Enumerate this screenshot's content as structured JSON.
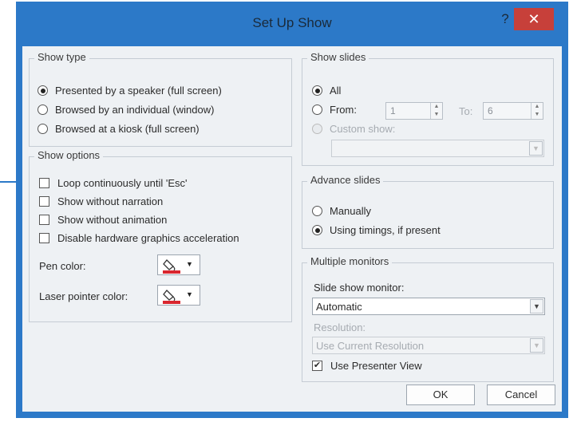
{
  "dialog": {
    "title": "Set Up Show",
    "help_glyph": "?",
    "close_glyph": "✕"
  },
  "show_type": {
    "legend": "Show type",
    "options": [
      {
        "label": "Presented by a speaker (full screen)",
        "selected": true
      },
      {
        "label": "Browsed by an individual (window)",
        "selected": false
      },
      {
        "label": "Browsed at a kiosk (full screen)",
        "selected": false
      }
    ]
  },
  "show_options": {
    "legend": "Show options",
    "checkboxes": [
      {
        "label": "Loop continuously until 'Esc'",
        "checked": false
      },
      {
        "label": "Show without narration",
        "checked": false
      },
      {
        "label": "Show without animation",
        "checked": false
      },
      {
        "label": "Disable hardware graphics acceleration",
        "checked": false
      }
    ],
    "pen_color_label": "Pen color:",
    "laser_color_label": "Laser pointer color:",
    "pen_color": "#d9262e",
    "laser_color": "#d9262e"
  },
  "show_slides": {
    "legend": "Show slides",
    "all_label": "All",
    "from_label": "From:",
    "from_value": "1",
    "to_label": "To:",
    "to_value": "6",
    "custom_label": "Custom show:",
    "custom_value": ""
  },
  "advance_slides": {
    "legend": "Advance slides",
    "manually_label": "Manually",
    "timings_label": "Using timings, if present",
    "selected": "timings"
  },
  "monitors": {
    "legend": "Multiple monitors",
    "monitor_label": "Slide show monitor:",
    "monitor_value": "Automatic",
    "resolution_label": "Resolution:",
    "resolution_value": "Use Current Resolution",
    "presenter_label": "Use Presenter View",
    "presenter_checked": true
  },
  "buttons": {
    "ok": "OK",
    "cancel": "Cancel"
  },
  "colors": {
    "title_bar": "#2c79c8",
    "close": "#c7403a",
    "client": "#eef1f4"
  }
}
